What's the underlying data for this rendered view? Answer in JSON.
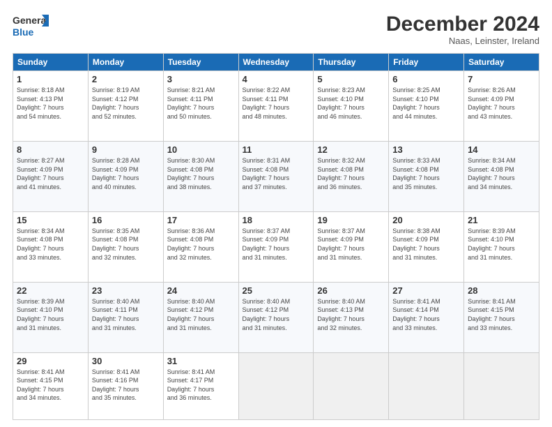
{
  "header": {
    "logo_line1": "General",
    "logo_line2": "Blue",
    "month": "December 2024",
    "location": "Naas, Leinster, Ireland"
  },
  "days_of_week": [
    "Sunday",
    "Monday",
    "Tuesday",
    "Wednesday",
    "Thursday",
    "Friday",
    "Saturday"
  ],
  "weeks": [
    [
      {
        "day": "1",
        "info": "Sunrise: 8:18 AM\nSunset: 4:13 PM\nDaylight: 7 hours\nand 54 minutes."
      },
      {
        "day": "2",
        "info": "Sunrise: 8:19 AM\nSunset: 4:12 PM\nDaylight: 7 hours\nand 52 minutes."
      },
      {
        "day": "3",
        "info": "Sunrise: 8:21 AM\nSunset: 4:11 PM\nDaylight: 7 hours\nand 50 minutes."
      },
      {
        "day": "4",
        "info": "Sunrise: 8:22 AM\nSunset: 4:11 PM\nDaylight: 7 hours\nand 48 minutes."
      },
      {
        "day": "5",
        "info": "Sunrise: 8:23 AM\nSunset: 4:10 PM\nDaylight: 7 hours\nand 46 minutes."
      },
      {
        "day": "6",
        "info": "Sunrise: 8:25 AM\nSunset: 4:10 PM\nDaylight: 7 hours\nand 44 minutes."
      },
      {
        "day": "7",
        "info": "Sunrise: 8:26 AM\nSunset: 4:09 PM\nDaylight: 7 hours\nand 43 minutes."
      }
    ],
    [
      {
        "day": "8",
        "info": "Sunrise: 8:27 AM\nSunset: 4:09 PM\nDaylight: 7 hours\nand 41 minutes."
      },
      {
        "day": "9",
        "info": "Sunrise: 8:28 AM\nSunset: 4:09 PM\nDaylight: 7 hours\nand 40 minutes."
      },
      {
        "day": "10",
        "info": "Sunrise: 8:30 AM\nSunset: 4:08 PM\nDaylight: 7 hours\nand 38 minutes."
      },
      {
        "day": "11",
        "info": "Sunrise: 8:31 AM\nSunset: 4:08 PM\nDaylight: 7 hours\nand 37 minutes."
      },
      {
        "day": "12",
        "info": "Sunrise: 8:32 AM\nSunset: 4:08 PM\nDaylight: 7 hours\nand 36 minutes."
      },
      {
        "day": "13",
        "info": "Sunrise: 8:33 AM\nSunset: 4:08 PM\nDaylight: 7 hours\nand 35 minutes."
      },
      {
        "day": "14",
        "info": "Sunrise: 8:34 AM\nSunset: 4:08 PM\nDaylight: 7 hours\nand 34 minutes."
      }
    ],
    [
      {
        "day": "15",
        "info": "Sunrise: 8:34 AM\nSunset: 4:08 PM\nDaylight: 7 hours\nand 33 minutes."
      },
      {
        "day": "16",
        "info": "Sunrise: 8:35 AM\nSunset: 4:08 PM\nDaylight: 7 hours\nand 32 minutes."
      },
      {
        "day": "17",
        "info": "Sunrise: 8:36 AM\nSunset: 4:08 PM\nDaylight: 7 hours\nand 32 minutes."
      },
      {
        "day": "18",
        "info": "Sunrise: 8:37 AM\nSunset: 4:09 PM\nDaylight: 7 hours\nand 31 minutes."
      },
      {
        "day": "19",
        "info": "Sunrise: 8:37 AM\nSunset: 4:09 PM\nDaylight: 7 hours\nand 31 minutes."
      },
      {
        "day": "20",
        "info": "Sunrise: 8:38 AM\nSunset: 4:09 PM\nDaylight: 7 hours\nand 31 minutes."
      },
      {
        "day": "21",
        "info": "Sunrise: 8:39 AM\nSunset: 4:10 PM\nDaylight: 7 hours\nand 31 minutes."
      }
    ],
    [
      {
        "day": "22",
        "info": "Sunrise: 8:39 AM\nSunset: 4:10 PM\nDaylight: 7 hours\nand 31 minutes."
      },
      {
        "day": "23",
        "info": "Sunrise: 8:40 AM\nSunset: 4:11 PM\nDaylight: 7 hours\nand 31 minutes."
      },
      {
        "day": "24",
        "info": "Sunrise: 8:40 AM\nSunset: 4:12 PM\nDaylight: 7 hours\nand 31 minutes."
      },
      {
        "day": "25",
        "info": "Sunrise: 8:40 AM\nSunset: 4:12 PM\nDaylight: 7 hours\nand 31 minutes."
      },
      {
        "day": "26",
        "info": "Sunrise: 8:40 AM\nSunset: 4:13 PM\nDaylight: 7 hours\nand 32 minutes."
      },
      {
        "day": "27",
        "info": "Sunrise: 8:41 AM\nSunset: 4:14 PM\nDaylight: 7 hours\nand 33 minutes."
      },
      {
        "day": "28",
        "info": "Sunrise: 8:41 AM\nSunset: 4:15 PM\nDaylight: 7 hours\nand 33 minutes."
      }
    ],
    [
      {
        "day": "29",
        "info": "Sunrise: 8:41 AM\nSunset: 4:15 PM\nDaylight: 7 hours\nand 34 minutes."
      },
      {
        "day": "30",
        "info": "Sunrise: 8:41 AM\nSunset: 4:16 PM\nDaylight: 7 hours\nand 35 minutes."
      },
      {
        "day": "31",
        "info": "Sunrise: 8:41 AM\nSunset: 4:17 PM\nDaylight: 7 hours\nand 36 minutes."
      },
      null,
      null,
      null,
      null
    ]
  ]
}
